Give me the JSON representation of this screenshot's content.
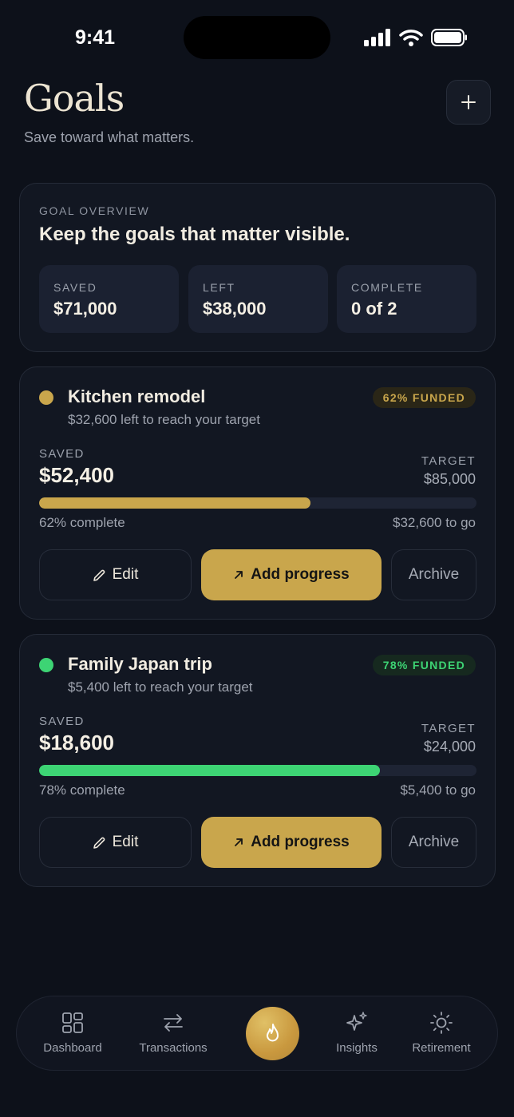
{
  "status_bar": {
    "time": "9:41"
  },
  "header": {
    "title": "Goals",
    "subtitle": "Save toward what matters.",
    "add_icon": "plus-icon"
  },
  "overview": {
    "eyebrow": "GOAL OVERVIEW",
    "headline": "Keep the goals that matter visible.",
    "stats": [
      {
        "label": "SAVED",
        "value": "$71,000"
      },
      {
        "label": "LEFT",
        "value": "$38,000"
      },
      {
        "label": "COMPLETE",
        "value": "0 of 2"
      }
    ]
  },
  "goals": [
    {
      "name": "Kitchen remodel",
      "left_text": "$32,600 left to reach your target",
      "badge": "62% FUNDED",
      "saved_label": "SAVED",
      "saved": "$52,400",
      "target_label": "TARGET",
      "target": "$85,000",
      "progress": 0.62,
      "complete_text": "62% complete",
      "to_go": "$32,600 to go",
      "accent": "#c9a64c",
      "badge_bg": "#2a2617",
      "edit_label": "Edit",
      "add_label": "Add progress",
      "archive_label": "Archive"
    },
    {
      "name": "Family Japan trip",
      "left_text": "$5,400 left to reach your target",
      "badge": "78% FUNDED",
      "saved_label": "SAVED",
      "saved": "$18,600",
      "target_label": "TARGET",
      "target": "$24,000",
      "progress": 0.78,
      "complete_text": "78% complete",
      "to_go": "$5,400 to go",
      "accent": "#3dd474",
      "badge_bg": "#16291f",
      "edit_label": "Edit",
      "add_label": "Add progress",
      "archive_label": "Archive"
    }
  ],
  "nav": {
    "items": [
      {
        "label": "Dashboard",
        "icon": "dashboard-grid-icon"
      },
      {
        "label": "Transactions",
        "icon": "transfer-arrows-icon"
      },
      {
        "label": "Insights",
        "icon": "sparkles-icon"
      },
      {
        "label": "Retirement",
        "icon": "sun-icon"
      }
    ],
    "center_icon": "flame-icon"
  },
  "colors": {
    "background": "#0d111a",
    "card": "#121722",
    "gold": "#c9a64c",
    "green": "#3dd474"
  }
}
